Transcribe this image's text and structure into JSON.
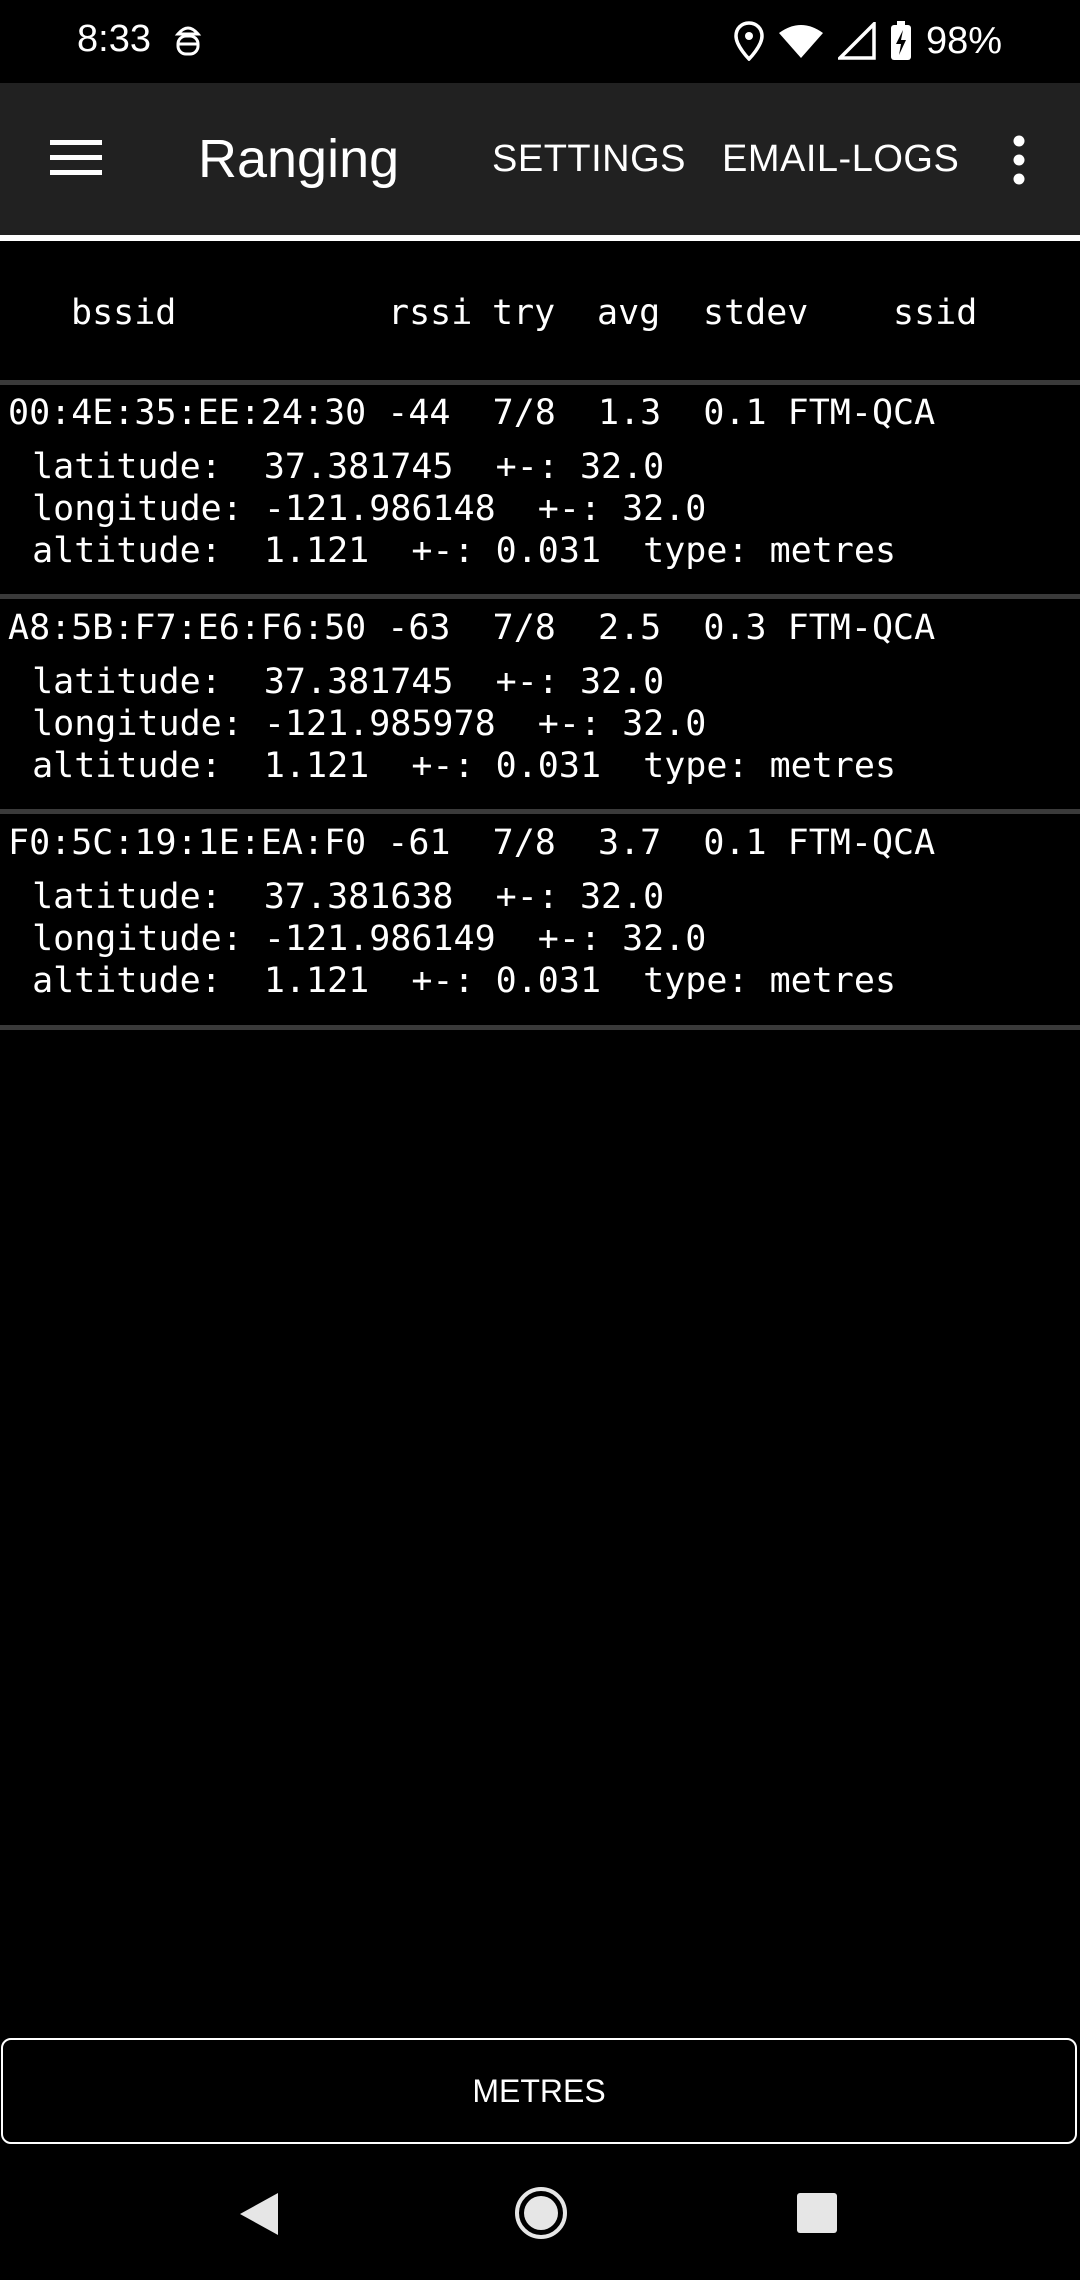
{
  "status_bar": {
    "time": "8:33",
    "battery": "98%",
    "icons": [
      "debug-icon",
      "location-icon",
      "wifi-icon",
      "cellular-icon",
      "battery-charging-icon"
    ]
  },
  "app_bar": {
    "title": "Ranging",
    "settings_label": "SETTINGS",
    "email_logs_label": "EMAIL-LOGS"
  },
  "table": {
    "headers": {
      "bssid": "bssid",
      "rssi": "rssi",
      "try": "try",
      "avg": "avg",
      "stdev": "stdev",
      "ssid": "ssid"
    },
    "entries": [
      {
        "summary": "00:4E:35:EE:24:30 -44  7/8  1.3  0.1 FTM-QCA",
        "latitude": " latitude:  37.381745  +-: 32.0",
        "longitude": " longitude: -121.986148  +-: 32.0",
        "altitude": " altitude:  1.121  +-: 0.031  type: metres"
      },
      {
        "summary": "A8:5B:F7:E6:F6:50 -63  7/8  2.5  0.3 FTM-QCA",
        "latitude": " latitude:  37.381745  +-: 32.0",
        "longitude": " longitude: -121.985978  +-: 32.0",
        "altitude": " altitude:  1.121  +-: 0.031  type: metres"
      },
      {
        "summary": "F0:5C:19:1E:EA:F0 -61  7/8  3.7  0.1 FTM-QCA",
        "latitude": " latitude:  37.381638  +-: 32.0",
        "longitude": " longitude: -121.986149  +-: 32.0",
        "altitude": " altitude:  1.121  +-: 0.031  type: metres"
      }
    ]
  },
  "bottom_button": {
    "label": "METRES"
  },
  "nav_bar": {
    "icons": [
      "back-icon",
      "home-icon",
      "recents-icon"
    ]
  }
}
